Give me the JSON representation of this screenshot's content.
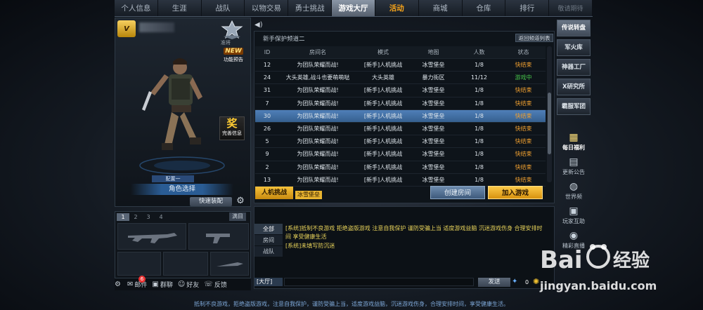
{
  "nav": {
    "tabs": [
      {
        "label": "个人信息"
      },
      {
        "label": "生涯"
      },
      {
        "label": "战队"
      },
      {
        "label": "以物交易"
      },
      {
        "label": "勇士挑战"
      },
      {
        "label": "游戏大厅"
      },
      {
        "label": "活动"
      },
      {
        "label": "商城"
      },
      {
        "label": "仓库"
      },
      {
        "label": "排行"
      },
      {
        "label": "敬请期待"
      }
    ]
  },
  "player": {
    "vip_label": "V",
    "rank_label": "准将",
    "new_tag": "NEW",
    "new_text": "功能预告",
    "reward_glyph": "奖",
    "reward_text": "完善信息",
    "set_label": "配置一",
    "role_select": "角色选择",
    "quick_equip": "快速装配"
  },
  "weapons": {
    "tabs": [
      "1",
      "2",
      "3",
      "4"
    ],
    "ammo_button": "满目"
  },
  "social": {
    "mail_label": "邮件",
    "mail_count": "6",
    "group_label": "群聊",
    "friends_label": "好友",
    "report_label": "反馈"
  },
  "room": {
    "channel_name": "新手保护频道二",
    "back_channel": "返回频道列表",
    "headers": {
      "id": "ID",
      "name": "房间名",
      "mode": "模式",
      "map": "地图",
      "players": "人数",
      "status": "状态"
    },
    "rows": [
      {
        "id": "12",
        "name": "为团队荣耀而战!",
        "mode": "[新手]人机挑战",
        "map": "冰雪堡垒",
        "players": "1/8",
        "status": "快结束",
        "status_type": "orange"
      },
      {
        "id": "24",
        "name": "大头英雄,战斗也要萌萌哒",
        "mode": "大头英雄",
        "map": "暴力街区",
        "players": "11/12",
        "status": "游戏中",
        "status_type": "green"
      },
      {
        "id": "31",
        "name": "为团队荣耀而战!",
        "mode": "[新手]人机挑战",
        "map": "冰雪堡垒",
        "players": "1/8",
        "status": "快结束",
        "status_type": "orange"
      },
      {
        "id": "7",
        "name": "为团队荣耀而战!",
        "mode": "[新手]人机挑战",
        "map": "冰雪堡垒",
        "players": "1/8",
        "status": "快结束",
        "status_type": "orange"
      },
      {
        "id": "30",
        "name": "为团队荣耀而战!",
        "mode": "[新手]人机挑战",
        "map": "冰雪堡垒",
        "players": "1/8",
        "status": "快结束",
        "status_type": "orange",
        "selected": true
      },
      {
        "id": "26",
        "name": "为团队荣耀而战!",
        "mode": "[新手]人机挑战",
        "map": "冰雪堡垒",
        "players": "1/8",
        "status": "快结束",
        "status_type": "orange"
      },
      {
        "id": "5",
        "name": "为团队荣耀而战!",
        "mode": "[新手]人机挑战",
        "map": "冰雪堡垒",
        "players": "1/8",
        "status": "快结束",
        "status_type": "orange"
      },
      {
        "id": "9",
        "name": "为团队荣耀而战!",
        "mode": "[新手]人机挑战",
        "map": "冰雪堡垒",
        "players": "1/8",
        "status": "快结束",
        "status_type": "orange"
      },
      {
        "id": "2",
        "name": "为团队荣耀而战!",
        "mode": "[新手]人机挑战",
        "map": "冰雪堡垒",
        "players": "1/8",
        "status": "快结束",
        "status_type": "orange"
      },
      {
        "id": "13",
        "name": "为团队荣耀而战!",
        "mode": "[新手]人机挑战",
        "map": "冰雪堡垒",
        "players": "1/8",
        "status": "快结束",
        "status_type": "orange"
      }
    ],
    "quick_join": "人机挑战",
    "quick_join_sub": "冰雪堡垒",
    "create_room": "创建房间",
    "join_game": "加入游戏"
  },
  "chat": {
    "tabs": [
      "全部",
      "房间",
      "战队"
    ],
    "messages": [
      "[系统]抵制不良游戏 拒绝盗版游戏 注意自我保护 谨防受骗上当 适度游戏益脑 沉迷游戏伤身 合理安排时间 享受健康生活",
      "[系统]未填写防沉迷"
    ],
    "channel": "[大厅]",
    "send": "发送",
    "counter": "0"
  },
  "sidebar": {
    "buttons": [
      "传说转盘",
      "军火库",
      "神器工厂",
      "X研究所",
      "霸服军团"
    ],
    "icons": [
      {
        "glyph": "▦",
        "label": "每日福利",
        "icon": "calendar-icon"
      },
      {
        "glyph": "▤",
        "label": "更新公告",
        "icon": "notice-icon"
      },
      {
        "glyph": "◍",
        "label": "世界频",
        "icon": "globe-icon"
      },
      {
        "glyph": "▣",
        "label": "玩家互助",
        "icon": "gift-icon"
      },
      {
        "glyph": "◉",
        "label": "精彩直播",
        "icon": "video-icon"
      }
    ]
  },
  "footer": "抵制不良游戏，拒绝盗版游戏，注意自我保护，谨防受骗上当，适度游戏益脑，沉迷游戏伤身，合理安排时间，享受健康生活。",
  "watermark": {
    "brand": "Bai 经验",
    "url": "jingyan.baidu.com"
  },
  "colors": {
    "accent_orange": "#f6a31a",
    "selected_row": "#4f7fb8",
    "status_green": "#46c44a",
    "status_orange": "#f0a030"
  }
}
